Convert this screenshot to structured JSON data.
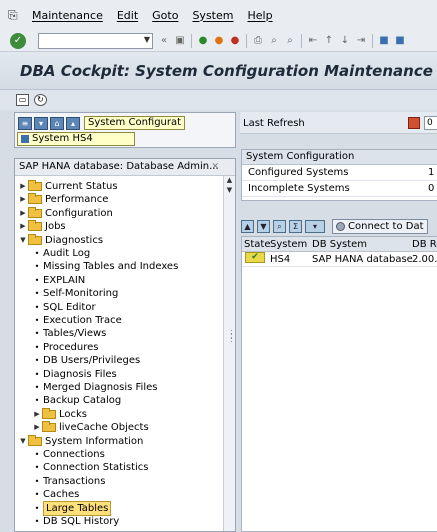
{
  "menu": {
    "items": [
      "Maintenance",
      "Edit",
      "Goto",
      "System",
      "Help"
    ]
  },
  "toolbar": {
    "command_field_value": "",
    "icons": [
      "ok-icon",
      "back-icon",
      "save-icon",
      "exit-icon",
      "cancel-icon",
      "print-icon",
      "find-icon",
      "find-next-icon",
      "first-page-icon",
      "prev-page-icon",
      "next-page-icon",
      "last-page-icon",
      "new-session-icon",
      "shortcut-icon"
    ]
  },
  "title": "DBA Cockpit: System Configuration Maintenance",
  "selection": {
    "config_button": "System Configurat",
    "system_label": "System HS4"
  },
  "nav": {
    "header": "SAP HANA database: Database Admin...",
    "items": [
      {
        "label": "Current Status",
        "type": "folder",
        "level": 0,
        "expanded": false
      },
      {
        "label": "Performance",
        "type": "folder",
        "level": 0,
        "expanded": false
      },
      {
        "label": "Configuration",
        "type": "folder",
        "level": 0,
        "expanded": false
      },
      {
        "label": "Jobs",
        "type": "folder",
        "level": 0,
        "expanded": false
      },
      {
        "label": "Diagnostics",
        "type": "folder",
        "level": 0,
        "expanded": true
      },
      {
        "label": "Audit Log",
        "type": "leaf",
        "level": 1
      },
      {
        "label": "Missing Tables and Indexes",
        "type": "leaf",
        "level": 1
      },
      {
        "label": "EXPLAIN",
        "type": "leaf",
        "level": 1
      },
      {
        "label": "Self-Monitoring",
        "type": "leaf",
        "level": 1
      },
      {
        "label": "SQL Editor",
        "type": "leaf",
        "level": 1
      },
      {
        "label": "Execution Trace",
        "type": "leaf",
        "level": 1
      },
      {
        "label": "Tables/Views",
        "type": "leaf",
        "level": 1
      },
      {
        "label": "Procedures",
        "type": "leaf",
        "level": 1
      },
      {
        "label": "DB Users/Privileges",
        "type": "leaf",
        "level": 1
      },
      {
        "label": "Diagnosis Files",
        "type": "leaf",
        "level": 1
      },
      {
        "label": "Merged Diagnosis Files",
        "type": "leaf",
        "level": 1
      },
      {
        "label": "Backup Catalog",
        "type": "leaf",
        "level": 1
      },
      {
        "label": "Locks",
        "type": "folder",
        "level": 1,
        "expanded": false
      },
      {
        "label": "liveCache Objects",
        "type": "folder",
        "level": 1,
        "expanded": false
      },
      {
        "label": "System Information",
        "type": "folder",
        "level": 0,
        "expanded": true
      },
      {
        "label": "Connections",
        "type": "leaf",
        "level": 1
      },
      {
        "label": "Connection Statistics",
        "type": "leaf",
        "level": 1
      },
      {
        "label": "Transactions",
        "type": "leaf",
        "level": 1
      },
      {
        "label": "Caches",
        "type": "leaf",
        "level": 1
      },
      {
        "label": "Large Tables",
        "type": "leaf",
        "level": 1,
        "selected": true
      },
      {
        "label": "DB SQL History",
        "type": "leaf",
        "level": 1
      }
    ]
  },
  "right": {
    "last_refresh_label": "Last Refresh",
    "last_refresh_value": "0",
    "syscfg": {
      "header": "System Configuration",
      "rows": [
        {
          "label": "Configured Systems",
          "value": "1"
        },
        {
          "label": "Incomplete Systems",
          "value": "0"
        }
      ]
    },
    "connect_button": "Connect to Dat",
    "grid": {
      "columns": [
        "State",
        "System",
        "DB System",
        "DB Re"
      ],
      "rows": [
        {
          "state": "✔",
          "system": "HS4",
          "db_system": "SAP HANA database",
          "db_release": "2.00."
        }
      ]
    }
  }
}
